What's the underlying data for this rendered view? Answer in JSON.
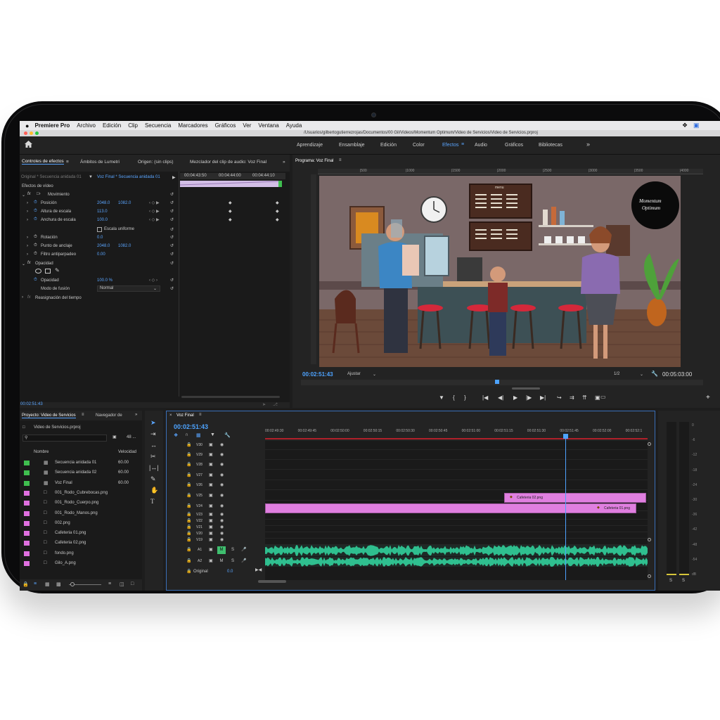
{
  "menubar": {
    "app": "Premiere Pro",
    "items": [
      "Archivo",
      "Edición",
      "Clip",
      "Secuencia",
      "Marcadores",
      "Gráficos",
      "Ver",
      "Ventana",
      "Ayuda"
    ]
  },
  "titlebar": {
    "path": "/Usuarios/gilbertogutierrezrojas/Documentos/00 Gil/Videos/Momentum Optimum/Video de Servicios/Video de Servicios.prproj"
  },
  "workspaces": {
    "tabs": [
      "Aprendizaje",
      "Ensamblaje",
      "Edición",
      "Color",
      "Efectos",
      "Audio",
      "Gráficos",
      "Bibliotecas"
    ],
    "active": "Efectos",
    "more": "»"
  },
  "effects_panel": {
    "tabs": [
      "Controles de efectos",
      "Ámbitos de Lumetri",
      "Origen: (sin clips)",
      "Mezclador del clip de audio: Voz Final"
    ],
    "more": "»",
    "source": "Original * Secuencia anidada 01",
    "target": "Voz Final * Secuencia anidada 01",
    "ruler": [
      "00:04:43:50",
      "00:04:44:00",
      "00:04:44:10"
    ],
    "section_label": "Efectos de vídeo",
    "motion": "Movimiento",
    "fx": "fx",
    "rows": [
      {
        "name": "Posición",
        "v1": "2048.0",
        "v2": "1082.0"
      },
      {
        "name": "Altura de escala",
        "v1": "113.0",
        "v2": ""
      },
      {
        "name": "Anchura de escala",
        "v1": "100.0",
        "v2": ""
      },
      {
        "name": "Escala uniforme",
        "v1": "",
        "v2": ""
      },
      {
        "name": "Rotación",
        "v1": "0.0",
        "v2": ""
      },
      {
        "name": "Punto de anclaje",
        "v1": "2048.0",
        "v2": "1082.0"
      },
      {
        "name": "Filtro antiparpadeo",
        "v1": "0.00",
        "v2": ""
      }
    ],
    "opacity_header": "Opacidad",
    "opacity": {
      "name": "Opacidad",
      "value": "100.0 %"
    },
    "blend": {
      "name": "Modo de fusión",
      "value": "Normal"
    },
    "time_remap": "Reasignación del tiempo",
    "timecode": "00:02:51:43"
  },
  "program_monitor": {
    "title": "Programa: Voz Final",
    "ruler": [
      "|500",
      "|1000",
      "|1500",
      "|2000",
      "|2500",
      "|3000",
      "|3500",
      "|4000"
    ],
    "timecode": "00:02:51:43",
    "fit": "Ajustar",
    "quality": "1/2",
    "duration": "00:05:03:00",
    "scene": {
      "menu_sign": "menu",
      "logo_line1": "Momentum",
      "logo_line2": "Optimum"
    }
  },
  "project_panel": {
    "tabs": [
      "Proyecto: Video de Servicios",
      "Navegador de"
    ],
    "more": "»",
    "file": "Video de Servicios.prproj",
    "count": "48 ...",
    "col_name": "Nombre",
    "col_rate": "Velocidad",
    "items": [
      {
        "name": "Secuencia anidada 01",
        "rate": "60.00",
        "color": "#3fbf4f",
        "kind": "sequence"
      },
      {
        "name": "Secuencia anidada 02",
        "rate": "60.00",
        "color": "#3fbf4f",
        "kind": "sequence"
      },
      {
        "name": "Voz Final",
        "rate": "60.00",
        "color": "#3fbf4f",
        "kind": "sequence"
      },
      {
        "name": "001_Rodo_Cubrebocas.png",
        "rate": "",
        "color": "#e070e0",
        "kind": "image"
      },
      {
        "name": "001_Rodo_Cuerpo.png",
        "rate": "",
        "color": "#e070e0",
        "kind": "image"
      },
      {
        "name": "001_Rodo_Manos.png",
        "rate": "",
        "color": "#e070e0",
        "kind": "image"
      },
      {
        "name": "002.png",
        "rate": "",
        "color": "#e070e0",
        "kind": "image"
      },
      {
        "name": "Cafeteria 01.png",
        "rate": "",
        "color": "#e070e0",
        "kind": "image"
      },
      {
        "name": "Cafeteria 02.png",
        "rate": "",
        "color": "#e070e0",
        "kind": "image"
      },
      {
        "name": "fondo.png",
        "rate": "",
        "color": "#e070e0",
        "kind": "image"
      },
      {
        "name": "Gilo_A.png",
        "rate": "",
        "color": "#e070e0",
        "kind": "image"
      }
    ]
  },
  "timeline": {
    "title": "Voz Final",
    "timecode": "00:02:51:43",
    "ruler": [
      "00:02:49:30",
      "00:02:49:45",
      "00:02:50:00",
      "00:02:50:15",
      "00:02:50:30",
      "00:02:50:45",
      "00:02:51:00",
      "00:02:51:15",
      "00:02:51:30",
      "00:02:51:45",
      "00:02:52:00",
      "00:02:52:1"
    ],
    "video_tracks": [
      "V30",
      "V29",
      "V28",
      "V27",
      "V26",
      "V25",
      "V24",
      "V23",
      "V22",
      "V21",
      "V20",
      "V19"
    ],
    "audio_tracks": [
      "A1",
      "A2"
    ],
    "master": {
      "name": "Original",
      "value": "0.0"
    },
    "clips": [
      {
        "label": "Cafeteria 02.png",
        "track": "V25"
      },
      {
        "label": "Cafeteria 01.png",
        "track": "V24"
      }
    ],
    "audio_buttons": {
      "mute": "M",
      "solo": "S"
    }
  },
  "meters": {
    "scale": [
      "0",
      "-6",
      "-12",
      "-18",
      "-24",
      "-30",
      "-36",
      "-42",
      "-48",
      "-54",
      "dB"
    ],
    "solo": [
      "S",
      "S"
    ]
  },
  "colors": {
    "accent": "#4da3ff",
    "clip": "#e07fe0",
    "audio": "#2fbf8f",
    "playhead": "#4da3ff"
  }
}
